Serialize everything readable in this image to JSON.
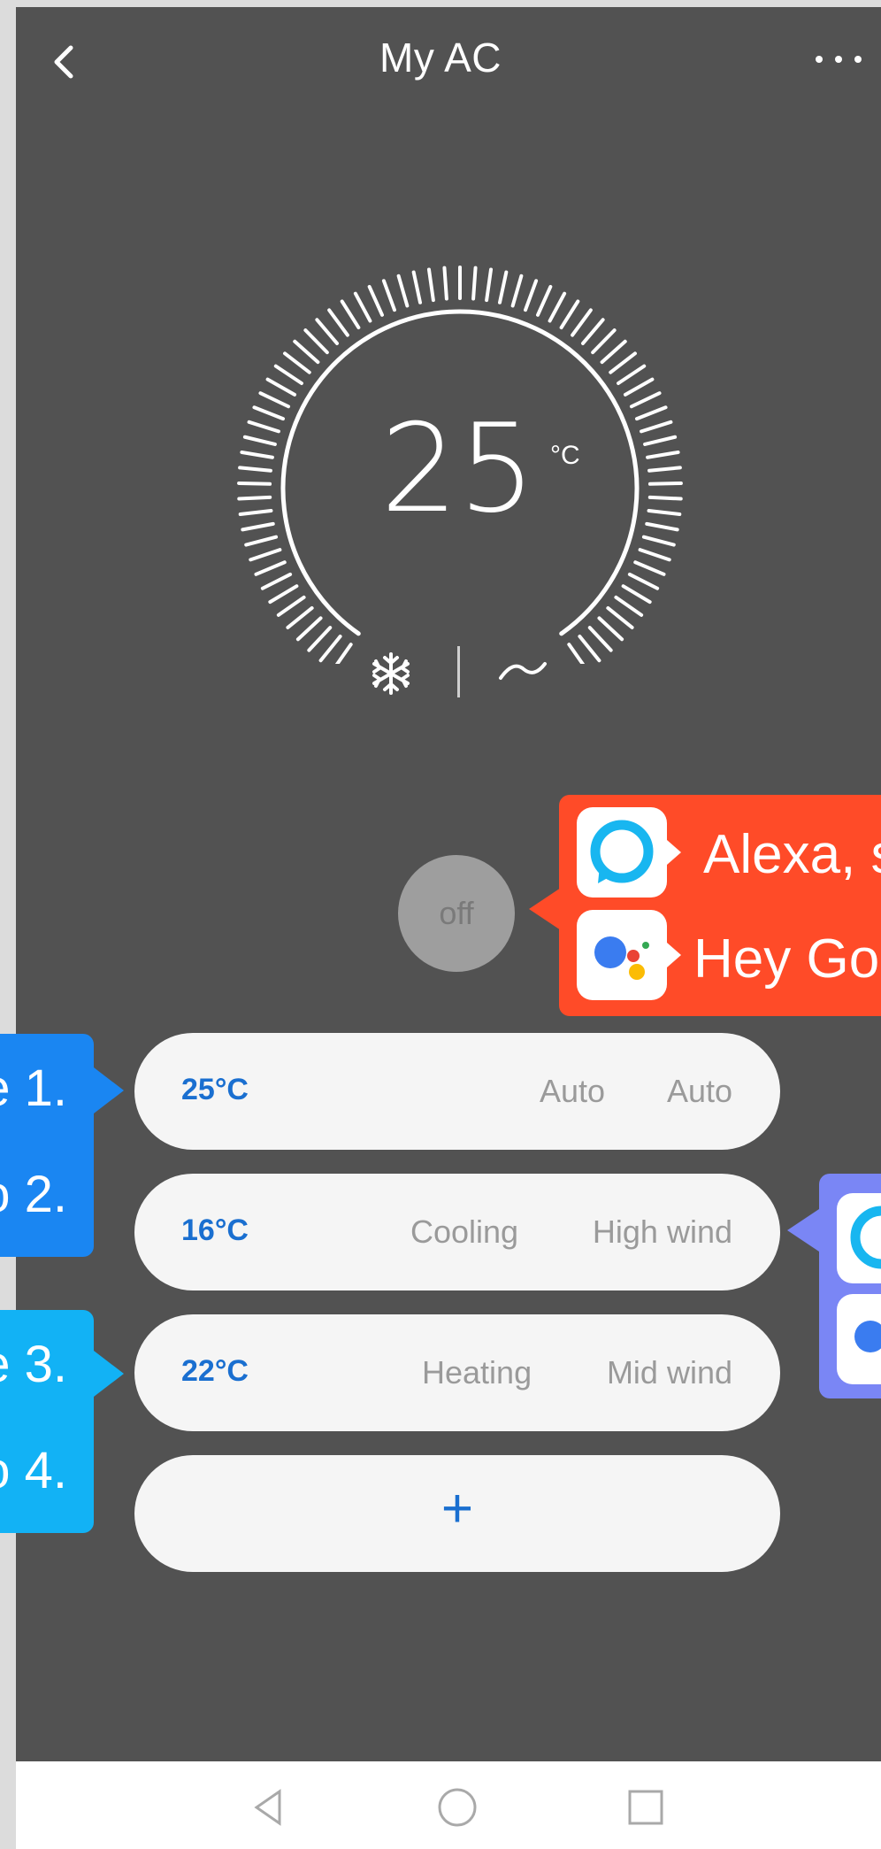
{
  "header": {
    "title": "My AC"
  },
  "thermostat": {
    "temperature": "25",
    "unit": "°C"
  },
  "power": {
    "label": "off"
  },
  "presets": [
    {
      "temp": "25°C",
      "mode": "Auto",
      "wind": "Auto"
    },
    {
      "temp": "16°C",
      "mode": "Cooling",
      "wind": "High wind"
    },
    {
      "temp": "22°C",
      "mode": "Heating",
      "wind": "Mid wind"
    }
  ],
  "add_preset": {
    "label": "+"
  },
  "callouts": {
    "voice": {
      "alexa_text": "Alexa, s",
      "google_text": "Hey Go"
    },
    "scenes": [
      "e 1.",
      "o 2.",
      "e 3.",
      "o 4."
    ]
  },
  "icons": {
    "back": "chevron-left-icon",
    "more": "more-dots-icon",
    "mode": "snowflake-icon",
    "fan": "fan-wave-icon",
    "nav_back": "triangle-back-icon",
    "nav_home": "circle-home-icon",
    "nav_recent": "square-recent-icon"
  },
  "colors": {
    "background": "#525252",
    "accent_blue": "#1a6fd0",
    "callout_red": "#ff4b28",
    "callout_blue": "#1a86f2",
    "callout_cyan": "#12b2f5",
    "callout_purple": "#7a86f5"
  }
}
